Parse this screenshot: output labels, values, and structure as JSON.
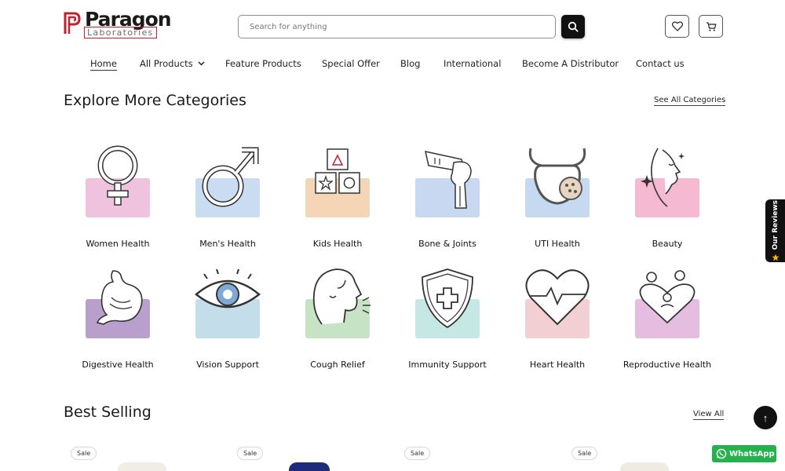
{
  "brand": {
    "name": "Paragon",
    "sub": "Laboratories",
    "accent": "#c5202e"
  },
  "search": {
    "placeholder": "Search for anything",
    "value": ""
  },
  "header_icons": [
    "search-icon",
    "heart-icon",
    "cart-icon"
  ],
  "nav": [
    {
      "label": "Home",
      "active": true
    },
    {
      "label": "All Products",
      "has_dropdown": true
    },
    {
      "label": "Feature Products"
    },
    {
      "label": "Special Offer"
    },
    {
      "label": "Blog"
    },
    {
      "label": "International"
    },
    {
      "label": "Become A Distributor"
    },
    {
      "label": "Contact us"
    }
  ],
  "categories_section": {
    "title": "Explore More Categories",
    "see_all": "See All Categories",
    "items": [
      {
        "label": "Women Health",
        "color": "#efc3dd",
        "icon": "female-symbol-icon"
      },
      {
        "label": "Men's Health",
        "color": "#c9dcf2",
        "icon": "male-symbol-icon"
      },
      {
        "label": "Kids Health",
        "color": "#f4d6b7",
        "icon": "toy-blocks-icon"
      },
      {
        "label": "Bone & Joints",
        "color": "#c8d8f0",
        "icon": "knee-joint-icon"
      },
      {
        "label": "UTI Health",
        "color": "#c5d9f1",
        "icon": "bladder-icon"
      },
      {
        "label": "Beauty",
        "color": "#f6b9d2",
        "icon": "face-profile-icon"
      },
      {
        "label": "Digestive Health",
        "color": "#b99fcc",
        "icon": "stomach-icon"
      },
      {
        "label": "Vision Support",
        "color": "#c3dde9",
        "icon": "eye-icon"
      },
      {
        "label": "Cough Relief",
        "color": "#c6e3c5",
        "icon": "cough-head-icon"
      },
      {
        "label": "Immunity Support",
        "color": "#c6e8e4",
        "icon": "shield-cross-icon"
      },
      {
        "label": "Heart Health",
        "color": "#f1cfd2",
        "icon": "heart-pulse-icon"
      },
      {
        "label": "Reproductive Health",
        "color": "#e4bde0",
        "icon": "family-heart-icon"
      }
    ]
  },
  "best_selling": {
    "title": "Best Selling",
    "view_all": "View All",
    "products": [
      {
        "badge": "Sale"
      },
      {
        "badge": "Sale"
      },
      {
        "badge": "Sale"
      },
      {
        "badge": "Sale"
      }
    ]
  },
  "floating": {
    "reviews": "Our Reviews",
    "scroll_top": "↑",
    "whatsapp": "WhatsApp"
  }
}
